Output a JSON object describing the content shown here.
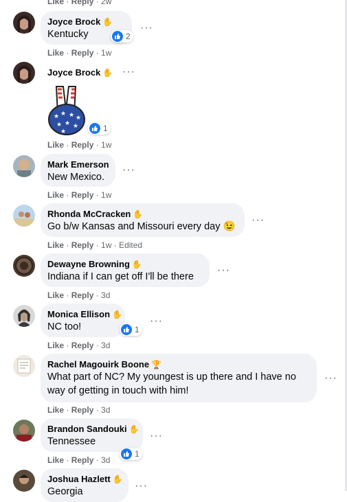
{
  "top_meta": {
    "like": "Like",
    "reply": "Reply",
    "time": "2w"
  },
  "comments": [
    {
      "name": "Joyce Brock",
      "text": "Kentucky",
      "like": "Like",
      "reply": "Reply",
      "time": "1w",
      "reactions": "2"
    },
    {
      "name": "Joyce Brock",
      "text": "",
      "like": "Like",
      "reply": "Reply",
      "time": "1w",
      "reactions": "1",
      "sticker": "peace-sign-usa-flag"
    },
    {
      "name": "Mark Emerson",
      "text": "New Mexico.",
      "like": "Like",
      "reply": "Reply",
      "time": "1w"
    },
    {
      "name": "Rhonda McCracken",
      "text": "Go b/w Kansas and Missouri every day 😉",
      "like": "Like",
      "reply": "Reply",
      "time": "1w",
      "edited": "Edited"
    },
    {
      "name": "Dewayne Browning",
      "text": "Indiana if I can get off I'll be there",
      "like": "Like",
      "reply": "Reply",
      "time": "3d"
    },
    {
      "name": "Monica Ellison",
      "text": "NC too!",
      "like": "Like",
      "reply": "Reply",
      "time": "3d",
      "reactions": "1"
    },
    {
      "name": "Rachel Magouirk Boone",
      "text": "What part of NC? My youngest is up there and I have no way of getting in touch with him!",
      "like": "Like",
      "reply": "Reply",
      "time": "3d"
    },
    {
      "name": "Brandon Sandouki",
      "text": "Tennessee",
      "like": "Like",
      "reply": "Reply",
      "time": "3d",
      "reactions": "1"
    },
    {
      "name": "Joshua Hazlett",
      "text": "Georgia"
    }
  ],
  "colors": {
    "bubble": "#f0f2f5",
    "meta": "#65676b",
    "like_blue": "#1877f2"
  },
  "icons": {
    "badge": "wave-icon",
    "more": "more-options-icon",
    "reaction": "like-icon"
  }
}
